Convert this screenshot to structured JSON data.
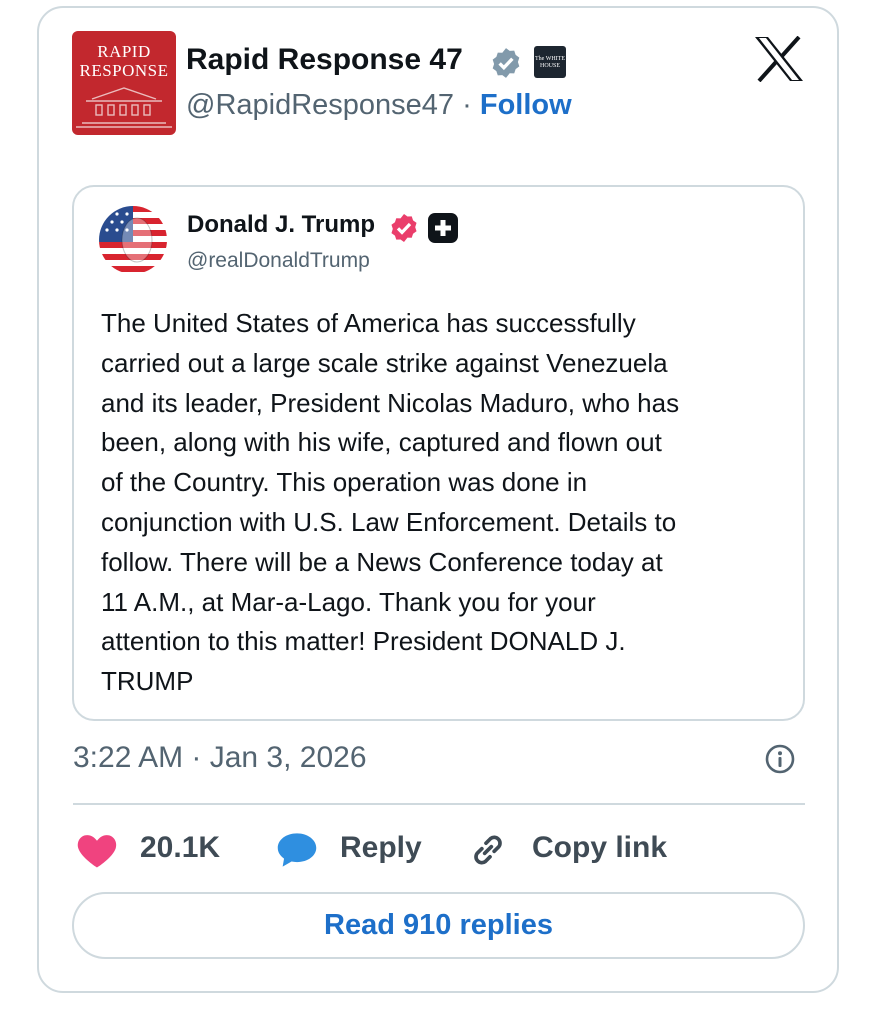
{
  "post": {
    "avatar_text_line1": "RAPID",
    "avatar_text_line2": "RESPONSE",
    "author_name": "Rapid Response 47",
    "handle": "@RapidResponse47",
    "separator": "·",
    "follow_label": "Follow",
    "affiliation_badge_text": "The WHITE HOUSE",
    "platform_icon": "x-logo-icon"
  },
  "quoted": {
    "author_name": "Donald J. Trump",
    "handle": "@realDonaldTrump",
    "text_lines": [
      "The United States of America has successfully",
      "carried out a large scale strike against Venezuela",
      "and its leader, President Nicolas Maduro, who has",
      "been, along with his wife, captured and flown out",
      "of the Country. This operation was done in",
      "conjunction with U.S. Law Enforcement. Details to",
      "follow. There will be a News Conference today at",
      "11 A.M., at Mar-a-Lago. Thank you for your",
      "attention to this matter! President DONALD J.",
      "TRUMP"
    ]
  },
  "meta": {
    "timestamp": "3:22 AM · Jan 3, 2026"
  },
  "actions": {
    "like_count": "20.1K",
    "reply_label": "Reply",
    "copy_link_label": "Copy link"
  },
  "read_replies_label": "Read 910 replies",
  "colors": {
    "accent_blue": "#1d6fc9",
    "like_pink": "#f0437f",
    "reply_blue": "#2f8fe0",
    "verified_gray": "#829aab",
    "verified_pink": "#ea3e6b",
    "avatar_red": "#c2282e"
  }
}
